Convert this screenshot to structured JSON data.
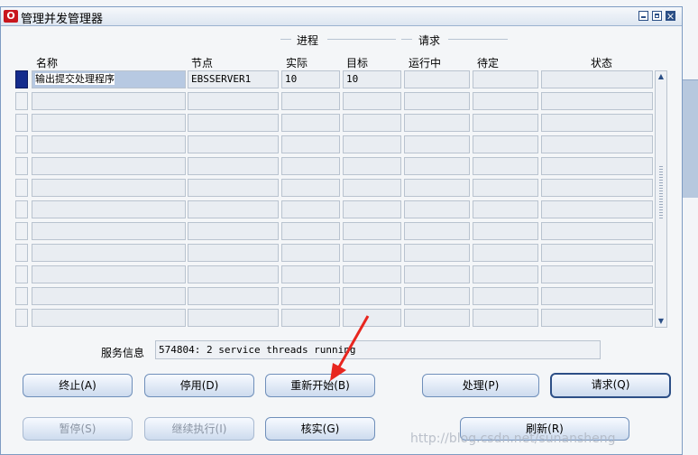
{
  "window": {
    "title": "管理并发管理器"
  },
  "groups": {
    "process": "进程",
    "request": "请求"
  },
  "columns": {
    "name": "名称",
    "node": "节点",
    "actual": "实际",
    "target": "目标",
    "running": "运行中",
    "pending": "待定",
    "status": "状态"
  },
  "rows": [
    {
      "name": "输出提交处理程序",
      "node": "EBSSERVER1",
      "actual": "10",
      "target": "10",
      "running": "",
      "pending": "",
      "status": ""
    },
    {
      "name": "",
      "node": "",
      "actual": "",
      "target": "",
      "running": "",
      "pending": "",
      "status": ""
    },
    {
      "name": "",
      "node": "",
      "actual": "",
      "target": "",
      "running": "",
      "pending": "",
      "status": ""
    },
    {
      "name": "",
      "node": "",
      "actual": "",
      "target": "",
      "running": "",
      "pending": "",
      "status": ""
    },
    {
      "name": "",
      "node": "",
      "actual": "",
      "target": "",
      "running": "",
      "pending": "",
      "status": ""
    },
    {
      "name": "",
      "node": "",
      "actual": "",
      "target": "",
      "running": "",
      "pending": "",
      "status": ""
    },
    {
      "name": "",
      "node": "",
      "actual": "",
      "target": "",
      "running": "",
      "pending": "",
      "status": ""
    },
    {
      "name": "",
      "node": "",
      "actual": "",
      "target": "",
      "running": "",
      "pending": "",
      "status": ""
    },
    {
      "name": "",
      "node": "",
      "actual": "",
      "target": "",
      "running": "",
      "pending": "",
      "status": ""
    },
    {
      "name": "",
      "node": "",
      "actual": "",
      "target": "",
      "running": "",
      "pending": "",
      "status": ""
    },
    {
      "name": "",
      "node": "",
      "actual": "",
      "target": "",
      "running": "",
      "pending": "",
      "status": ""
    },
    {
      "name": "",
      "node": "",
      "actual": "",
      "target": "",
      "running": "",
      "pending": "",
      "status": ""
    }
  ],
  "service_info": {
    "label": "服务信息",
    "value": "574804: 2 service threads running"
  },
  "buttons": {
    "terminate": "终止(A)",
    "deactivate": "停用(D)",
    "restart": "重新开始(B)",
    "process": "处理(P)",
    "requests": "请求(Q)",
    "suspend": "暂停(S)",
    "resume": "继续执行(I)",
    "verify": "核实(G)",
    "refresh": "刷新(R)"
  },
  "watermark": "http://blog.csdn.net/sunansheng",
  "colors": {
    "accent": "#2d4f86",
    "annotation_arrow": "#e8261f"
  }
}
